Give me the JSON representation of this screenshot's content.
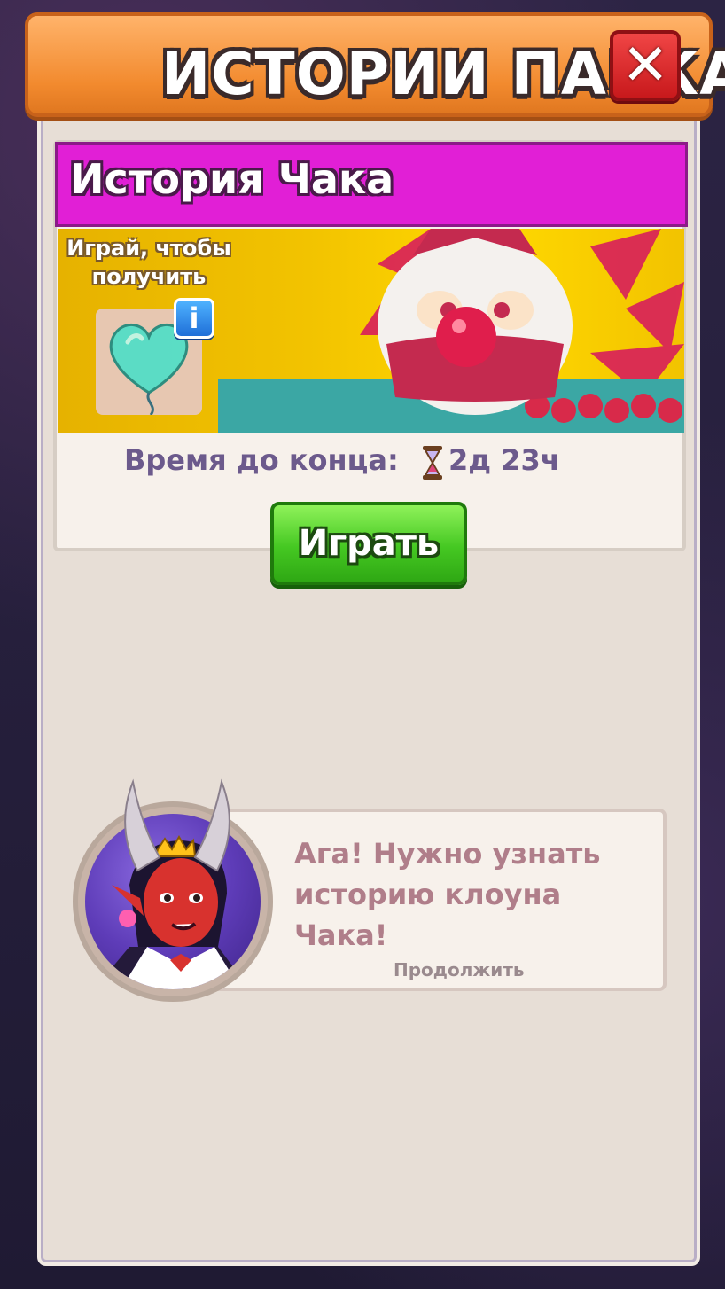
{
  "header": {
    "title": "ИСТОРИИ ПАРКА",
    "close_icon": "close-x-icon"
  },
  "story": {
    "title": "История Чака",
    "reward_label": "Играй, чтобы получить",
    "reward_item": "heart-balloon-icon",
    "info_icon": "info-icon",
    "timer_label": "Время до конца:",
    "timer_icon": "hourglass-icon",
    "timer_value": "2д 23ч",
    "play_label": "Играть"
  },
  "dialog": {
    "text": "Ага! Нужно узнать историю клоуна Чака!",
    "continue_label": "Продолжить",
    "speaker_avatar": "devil-girl-avatar"
  },
  "colors": {
    "header_orange": "#f28a2e",
    "story_header_magenta": "#e11fd6",
    "play_green": "#45c822",
    "close_red": "#c8191c",
    "timer_text": "#6c5a8c",
    "dialog_text": "#b07e8a"
  }
}
